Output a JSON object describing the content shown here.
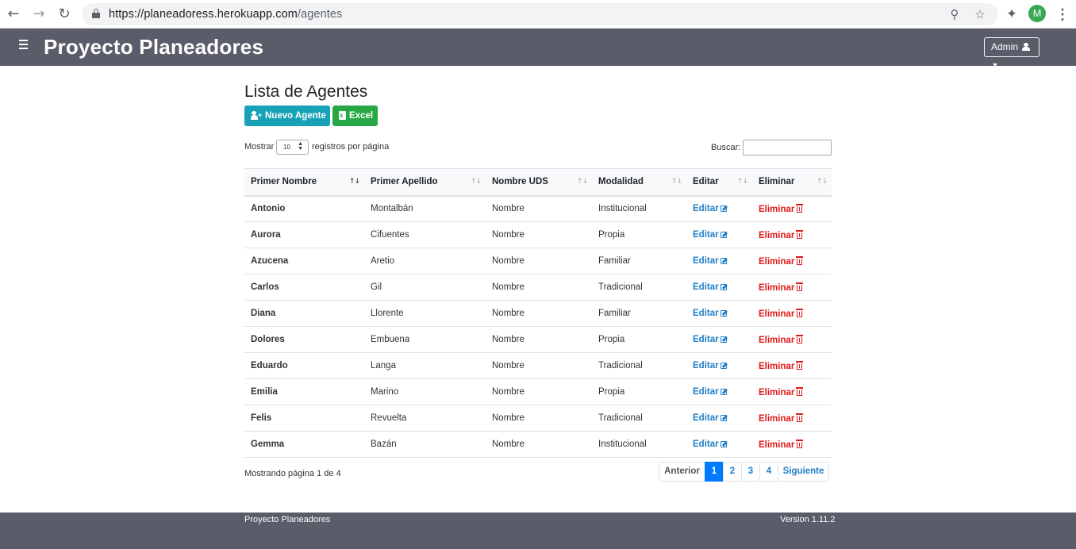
{
  "browser": {
    "url_host": "https://planeadoress.herokuapp.com",
    "url_path": "/agentes",
    "profile_initial": "M"
  },
  "header": {
    "title": "Proyecto Planeadores",
    "admin_label": "Admin"
  },
  "main": {
    "title": "Lista de Agentes",
    "new_button": "Nuevo Agente",
    "excel_button": "Excel",
    "show_label": "Mostrar",
    "page_size": "10",
    "per_page_label": "registros por página",
    "search_label": "Buscar:",
    "search_value": ""
  },
  "table": {
    "columns": [
      "Primer Nombre",
      "Primer Apellido",
      "Nombre UDS",
      "Modalidad",
      "Editar",
      "Eliminar"
    ],
    "edit_label": "Editar",
    "delete_label": "Eliminar",
    "rows": [
      {
        "nombre": "Antonio",
        "apellido": "Montalbán",
        "uds": "Nombre",
        "modalidad": "Institucional"
      },
      {
        "nombre": "Aurora",
        "apellido": "Cifuentes",
        "uds": "Nombre",
        "modalidad": "Propia"
      },
      {
        "nombre": "Azucena",
        "apellido": "Aretio",
        "uds": "Nombre",
        "modalidad": "Familiar"
      },
      {
        "nombre": "Carlos",
        "apellido": "Gil",
        "uds": "Nombre",
        "modalidad": "Tradicional"
      },
      {
        "nombre": "Diana",
        "apellido": "Llorente",
        "uds": "Nombre",
        "modalidad": "Familiar"
      },
      {
        "nombre": "Dolores",
        "apellido": "Embuena",
        "uds": "Nombre",
        "modalidad": "Propia"
      },
      {
        "nombre": "Eduardo",
        "apellido": "Langa",
        "uds": "Nombre",
        "modalidad": "Tradicional"
      },
      {
        "nombre": "Emilia",
        "apellido": "Marino",
        "uds": "Nombre",
        "modalidad": "Propia"
      },
      {
        "nombre": "Felis",
        "apellido": "Revuelta",
        "uds": "Nombre",
        "modalidad": "Tradicional"
      },
      {
        "nombre": "Gemma",
        "apellido": "Bazán",
        "uds": "Nombre",
        "modalidad": "Institucional"
      }
    ]
  },
  "pagination": {
    "info": "Mostrando página 1 de 4",
    "prev": "Anterior",
    "pages": [
      "1",
      "2",
      "3",
      "4"
    ],
    "current": "1",
    "next": "Siguiente"
  },
  "footer": {
    "left": "Proyecto Planeadores",
    "right": "Version 1.11.2"
  },
  "colors": {
    "header_bg": "#5a5c69",
    "new_button": "#17a2b8",
    "excel_button": "#28a745",
    "active_page": "#007bff",
    "edit": "#1e7ec8",
    "delete": "#e01818"
  }
}
